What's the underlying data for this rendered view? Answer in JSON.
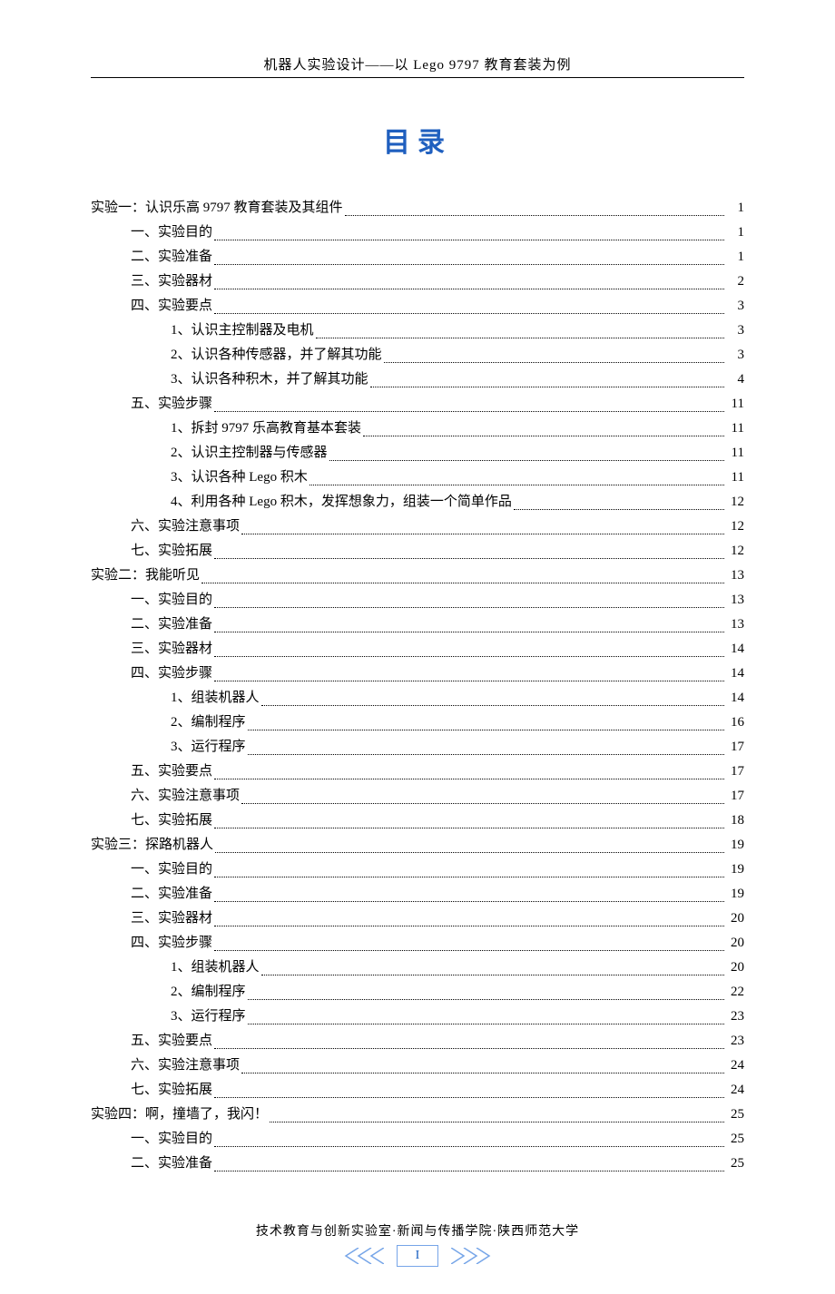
{
  "header": "机器人实验设计——以 Lego 9797 教育套装为例",
  "title": "目录",
  "footer_org": "技术教育与创新实验室·新闻与传播学院·陕西师范大学",
  "page_number": "I",
  "toc": [
    {
      "level": 0,
      "label": "实验一：认识乐高 9797 教育套装及其组件",
      "page": "1"
    },
    {
      "level": 1,
      "label": "一、实验目的",
      "page": "1"
    },
    {
      "level": 1,
      "label": "二、实验准备",
      "page": "1"
    },
    {
      "level": 1,
      "label": "三、实验器材",
      "page": "2"
    },
    {
      "level": 1,
      "label": "四、实验要点",
      "page": "3"
    },
    {
      "level": 2,
      "label": "1、认识主控制器及电机",
      "page": "3"
    },
    {
      "level": 2,
      "label": "2、认识各种传感器，并了解其功能",
      "page": "3"
    },
    {
      "level": 2,
      "label": "3、认识各种积木，并了解其功能",
      "page": "4"
    },
    {
      "level": 1,
      "label": "五、实验步骤",
      "page": "11"
    },
    {
      "level": 2,
      "label": "1、拆封 9797 乐高教育基本套装",
      "page": "11"
    },
    {
      "level": 2,
      "label": "2、认识主控制器与传感器",
      "page": "11"
    },
    {
      "level": 2,
      "label": "3、认识各种 Lego 积木",
      "page": "11"
    },
    {
      "level": 2,
      "label": "4、利用各种 Lego 积木，发挥想象力，组装一个简单作品",
      "page": "12"
    },
    {
      "level": 1,
      "label": "六、实验注意事项",
      "page": "12"
    },
    {
      "level": 1,
      "label": "七、实验拓展",
      "page": "12"
    },
    {
      "level": 0,
      "label": "实验二：我能听见",
      "page": "13"
    },
    {
      "level": 1,
      "label": "一、实验目的",
      "page": "13"
    },
    {
      "level": 1,
      "label": "二、实验准备",
      "page": "13"
    },
    {
      "level": 1,
      "label": "三、实验器材",
      "page": "14"
    },
    {
      "level": 1,
      "label": "四、实验步骤",
      "page": "14"
    },
    {
      "level": 2,
      "label": "1、组装机器人",
      "page": "14"
    },
    {
      "level": 2,
      "label": "2、编制程序",
      "page": "16"
    },
    {
      "level": 2,
      "label": "3、运行程序",
      "page": "17"
    },
    {
      "level": 1,
      "label": "五、实验要点",
      "page": "17"
    },
    {
      "level": 1,
      "label": "六、实验注意事项",
      "page": "17"
    },
    {
      "level": 1,
      "label": "七、实验拓展",
      "page": "18"
    },
    {
      "level": 0,
      "label": "实验三：探路机器人",
      "page": "19"
    },
    {
      "level": 1,
      "label": "一、实验目的",
      "page": "19"
    },
    {
      "level": 1,
      "label": "二、实验准备",
      "page": "19"
    },
    {
      "level": 1,
      "label": "三、实验器材",
      "page": "20"
    },
    {
      "level": 1,
      "label": "四、实验步骤",
      "page": "20"
    },
    {
      "level": 2,
      "label": "1、组装机器人",
      "page": "20"
    },
    {
      "level": 2,
      "label": "2、编制程序",
      "page": "22"
    },
    {
      "level": 2,
      "label": "3、运行程序",
      "page": "23"
    },
    {
      "level": 1,
      "label": "五、实验要点",
      "page": "23"
    },
    {
      "level": 1,
      "label": "六、实验注意事项",
      "page": "24"
    },
    {
      "level": 1,
      "label": "七、实验拓展",
      "page": "24"
    },
    {
      "level": 0,
      "label": "实验四：啊，撞墙了，我闪！",
      "page": "25"
    },
    {
      "level": 1,
      "label": "一、实验目的",
      "page": "25"
    },
    {
      "level": 1,
      "label": "二、实验准备",
      "page": "25"
    }
  ]
}
